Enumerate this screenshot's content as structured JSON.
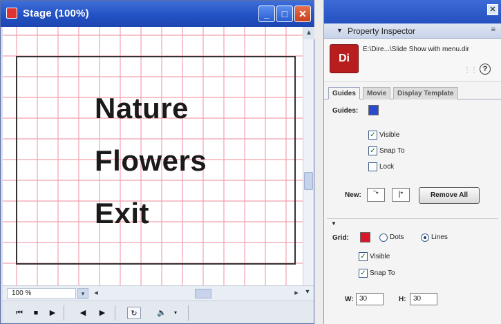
{
  "stage": {
    "title": "Stage (100%)",
    "menu_items": [
      "Nature",
      "Flowers",
      "Exit"
    ],
    "zoom": "100 %",
    "colors": {
      "grid_line": "#f2a0ad",
      "title_bar": "#2352c4"
    }
  },
  "inspector": {
    "panel_title": "Property Inspector",
    "file_path": "E:\\Dire...\\Slide Show with menu.dir",
    "file_icon_text": "Di",
    "tabs": [
      "Guides",
      "Movie",
      "Display Template"
    ],
    "guides": {
      "label": "Guides:",
      "visible_label": "Visible",
      "snap_label": "Snap To",
      "lock_label": "Lock",
      "visible_checked": true,
      "snap_checked": true,
      "lock_checked": false,
      "new_label": "New:",
      "remove_all": "Remove All"
    },
    "grid": {
      "label": "Grid:",
      "dots_label": "Dots",
      "lines_label": "Lines",
      "visible_label": "Visible",
      "snap_label": "Snap To",
      "w_label": "W:",
      "w_value": "30",
      "h_label": "H:",
      "h_value": "30"
    }
  }
}
